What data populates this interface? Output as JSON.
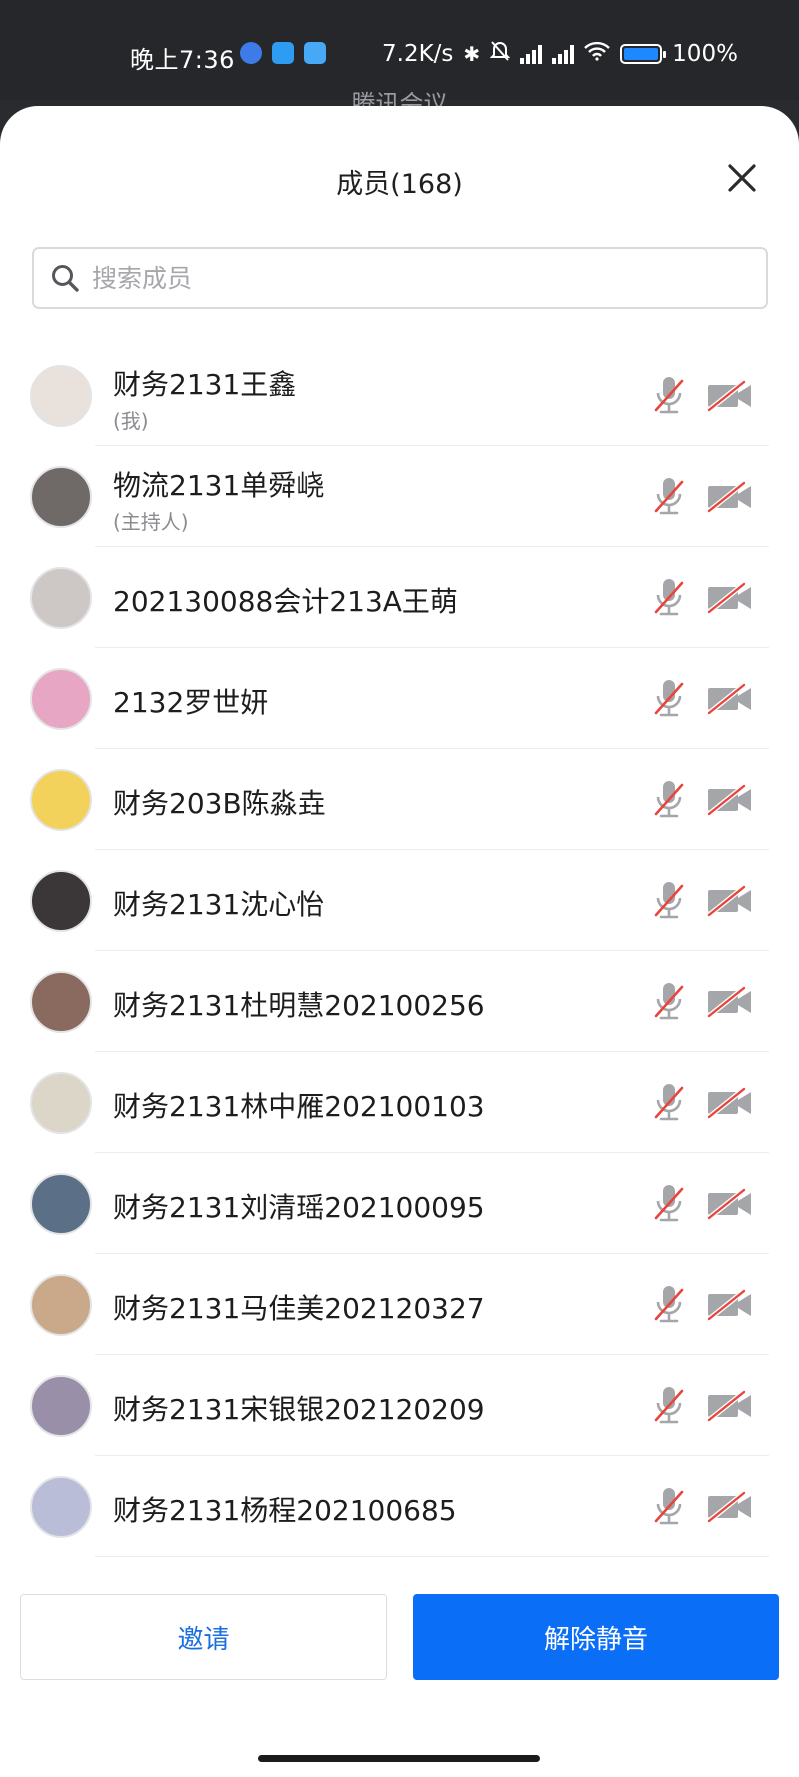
{
  "status_bar": {
    "time": "晚上7:36",
    "network_speed": "7.2K/s",
    "battery": "100%",
    "icons": [
      "bubble-app-icon",
      "cloud-app-icon",
      "chat-app-icon",
      "bluetooth-icon",
      "mute-bell-icon",
      "hd-signal-icon",
      "hd-signal-icon",
      "wifi-icon",
      "battery-icon"
    ],
    "battery_color": "#1e88ff"
  },
  "background_title": "腾讯会议",
  "sheet": {
    "title": "成员(168)",
    "close_icon": "close-icon"
  },
  "search": {
    "placeholder": "搜索成员",
    "value": ""
  },
  "members": [
    {
      "name": "财务2131王鑫",
      "role": "(我)",
      "mic": "muted",
      "camera": "off",
      "avatar_color": "#e9e1dc"
    },
    {
      "name": "物流2131单舜峣",
      "role": "(主持人)",
      "mic": "muted",
      "camera": "off",
      "avatar_color": "#6f6a68"
    },
    {
      "name": "202130088会计213A王萌",
      "role": "",
      "mic": "muted",
      "camera": "off",
      "avatar_color": "#cdc8c6"
    },
    {
      "name": "2132罗世妍",
      "role": "",
      "mic": "muted",
      "camera": "off",
      "avatar_color": "#e7a7c4"
    },
    {
      "name": "财务203B陈淼垚",
      "role": "",
      "mic": "muted",
      "camera": "off",
      "avatar_color": "#f3d25b"
    },
    {
      "name": "财务2131沈心怡",
      "role": "",
      "mic": "muted",
      "camera": "off",
      "avatar_color": "#3b3637"
    },
    {
      "name": "财务2131杜明慧202100256",
      "role": "",
      "mic": "muted",
      "camera": "off",
      "avatar_color": "#8a6a5e"
    },
    {
      "name": "财务2131林中雁202100103",
      "role": "",
      "mic": "muted",
      "camera": "off",
      "avatar_color": "#dcd6c9"
    },
    {
      "name": "财务2131刘清瑶202100095",
      "role": "",
      "mic": "muted",
      "camera": "off",
      "avatar_color": "#5b6f86"
    },
    {
      "name": "财务2131马佳美202120327",
      "role": "",
      "mic": "muted",
      "camera": "off",
      "avatar_color": "#c9a98a"
    },
    {
      "name": "财务2131宋银银202120209",
      "role": "",
      "mic": "muted",
      "camera": "off",
      "avatar_color": "#9a8fa8"
    },
    {
      "name": "财务2131杨程202100685",
      "role": "",
      "mic": "muted",
      "camera": "off",
      "avatar_color": "#b9bdd7"
    }
  ],
  "buttons": {
    "invite": "邀请",
    "unmute_all": "解除静音"
  },
  "colors": {
    "accent_blue": "#0b6ef7",
    "invite_text": "#1a6fe0",
    "muted_red": "#e8453c",
    "icon_gray": "#a5a6aa"
  }
}
